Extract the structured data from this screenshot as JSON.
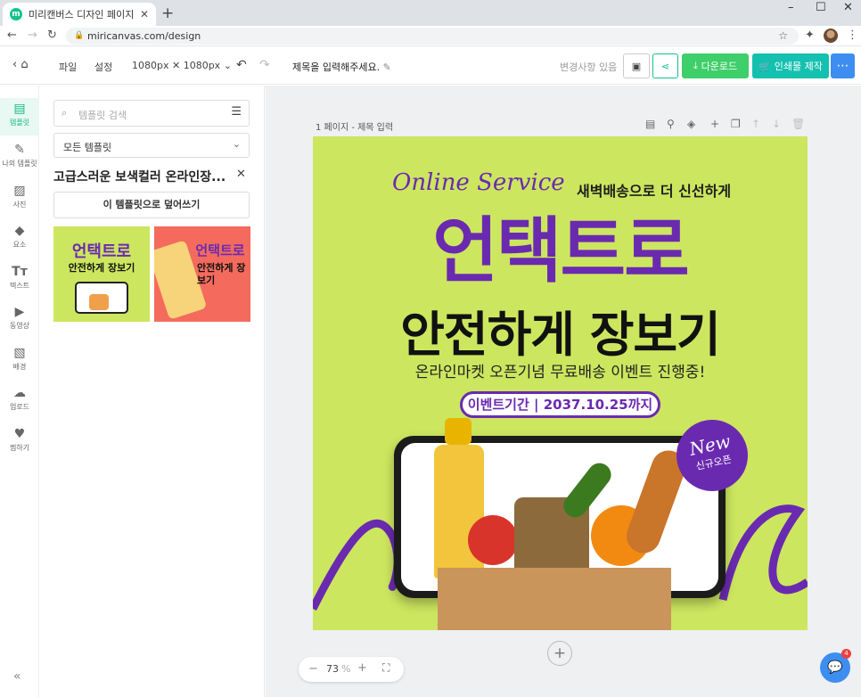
{
  "browser": {
    "tab_title": "미리캔버스 디자인 페이지",
    "favicon_letter": "m",
    "url": "miricanvas.com/design"
  },
  "header": {
    "file": "파일",
    "settings": "설정",
    "size": "1080px ✕ 1080px",
    "title_placeholder": "제목을 입력해주세요.",
    "status": "변경사항 있음",
    "download": "다운로드",
    "print": "인쇄물 제작"
  },
  "rail": [
    {
      "label": "템플릿",
      "icon": "template-icon"
    },
    {
      "label": "나의 템플릿",
      "icon": "my-template-icon"
    },
    {
      "label": "사진",
      "icon": "photo-icon"
    },
    {
      "label": "요소",
      "icon": "elements-icon"
    },
    {
      "label": "텍스트",
      "icon": "text-icon"
    },
    {
      "label": "동영상",
      "icon": "video-icon"
    },
    {
      "label": "배경",
      "icon": "background-icon"
    },
    {
      "label": "업로드",
      "icon": "upload-icon"
    },
    {
      "label": "찜하기",
      "icon": "heart-icon"
    }
  ],
  "panel": {
    "search_placeholder": "템플릿 검색",
    "filter": "모든 템플릿",
    "template_title": "고급스러운 보색컬러 온라인장...",
    "apply": "이 템플릿으로 덮어쓰기",
    "thumb1_big": "언택트로",
    "thumb1_line": "안전하게 장보기",
    "thumb2_big": "언택트로",
    "thumb2_line": "안전하게 장보기"
  },
  "canvas": {
    "page_label": "1 페이지 - 제목 입력",
    "zoom": "73",
    "zoom_unit": "%"
  },
  "design": {
    "script": "Online Service",
    "sub": "새벽배송으로 더 신선하게",
    "big1": "언택트로",
    "big2": "안전하게 장보기",
    "line": "온라인마켓 오픈기념 무료배송 이벤트 진행중!",
    "pill": "이벤트기간 | 2037.10.25까지",
    "badge_main": "New",
    "badge_sub": "신규오픈"
  },
  "chat": {
    "count": "4"
  },
  "colors": {
    "accent": "#13c28e",
    "purple": "#6a2ab0",
    "lime": "#cde65f",
    "blue": "#3d8ef0"
  }
}
